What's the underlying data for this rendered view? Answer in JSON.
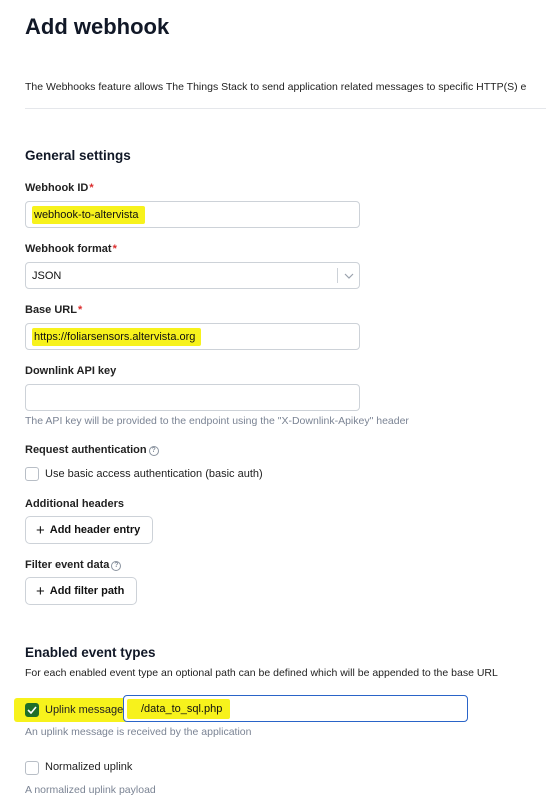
{
  "page": {
    "title": "Add webhook",
    "intro": "The Webhooks feature allows The Things Stack to send application related messages to specific HTTP(S) e"
  },
  "general": {
    "title": "General settings",
    "webhook_id": {
      "label": "Webhook ID",
      "value": "webhook-to-altervista"
    },
    "format": {
      "label": "Webhook format",
      "value": "JSON"
    },
    "base_url": {
      "label": "Base URL",
      "value": "https://foliarsensors.altervista.org"
    },
    "downlink_key": {
      "label": "Downlink API key",
      "value": "",
      "hint": "The API key will be provided to the endpoint using the \"X-Downlink-Apikey\" header"
    },
    "request_auth": {
      "label": "Request authentication",
      "checkbox_label": "Use basic access authentication (basic auth)",
      "checked": false
    },
    "additional_headers": {
      "label": "Additional headers",
      "button": "Add header entry"
    },
    "filter_event": {
      "label": "Filter event data",
      "button": "Add filter path"
    }
  },
  "events": {
    "title": "Enabled event types",
    "description": "For each enabled event type an optional path can be defined which will be appended to the base URL",
    "uplink": {
      "label": "Uplink message",
      "checked": true,
      "path": "/data_to_sql.php",
      "hint": "An uplink message is received by the application"
    },
    "normalized": {
      "label": "Normalized uplink",
      "checked": false,
      "hint": "A normalized uplink payload"
    }
  },
  "colors": {
    "highlight": "#f7f21c",
    "required": "#db2d2d",
    "checked": "#1f6f29",
    "focus_border": "#2a64c8"
  },
  "icons": {
    "required": "asterisk",
    "help": "question-circle-icon",
    "select_arrow": "chevron-down-icon",
    "add": "plus-icon",
    "check": "check-icon"
  }
}
